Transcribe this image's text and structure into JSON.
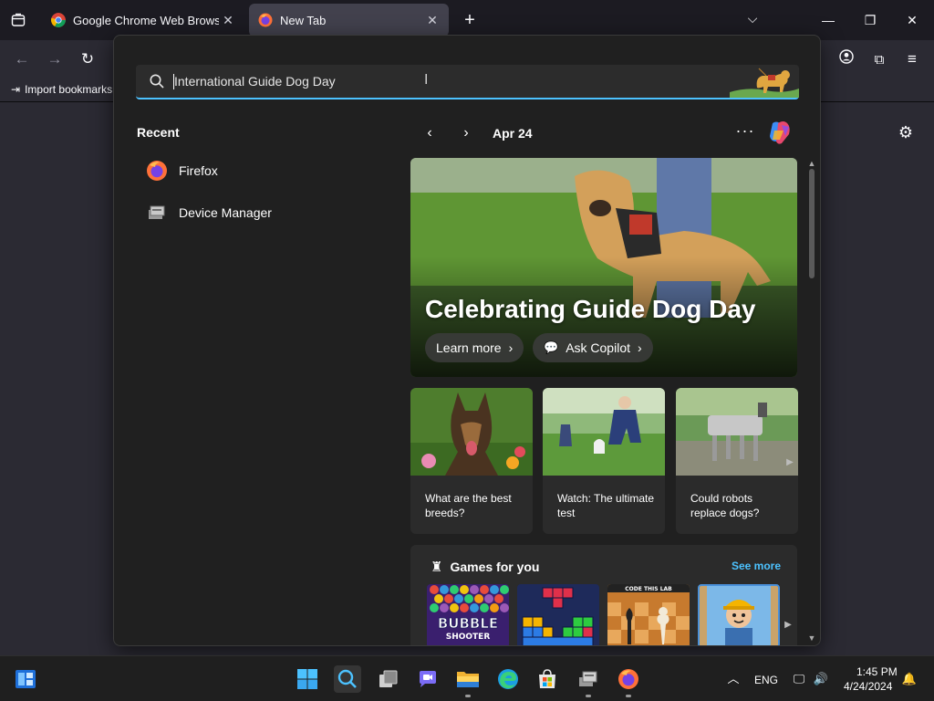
{
  "browser": {
    "tabs": [
      {
        "title": "Google Chrome Web Browser",
        "active": false
      },
      {
        "title": "New Tab",
        "active": true
      }
    ],
    "bookmarks_bar": {
      "import_label": "Import bookmarks..."
    }
  },
  "search": {
    "query": "International Guide Dog Day",
    "recent_title": "Recent",
    "recent_items": [
      {
        "label": "Firefox",
        "icon": "firefox-icon"
      },
      {
        "label": "Device Manager",
        "icon": "device-manager-icon"
      }
    ],
    "date": "Apr 24",
    "hero": {
      "title": "Celebrating Guide Dog Day",
      "learn_more": "Learn more",
      "ask_copilot": "Ask Copilot"
    },
    "cards": [
      {
        "text": "What are the best breeds?"
      },
      {
        "text": "Watch: The ultimate test"
      },
      {
        "text": "Could robots replace dogs?"
      }
    ],
    "games": {
      "title": "Games for you",
      "see_more": "See more",
      "tiles": [
        "Bubble Shooter HD",
        "Block puzzle",
        "Chess",
        "Construction kid"
      ],
      "bubble_label_1": "BUBBLE",
      "bubble_label_2": "SHOOTER",
      "code_label": "CODE THIS LAB"
    }
  },
  "taskbar": {
    "language": "ENG",
    "time": "1:45 PM",
    "date": "4/24/2024"
  },
  "colors": {
    "accent": "#4cc2ff",
    "flyout_bg": "#202020",
    "card_bg": "#2b2b2b"
  }
}
